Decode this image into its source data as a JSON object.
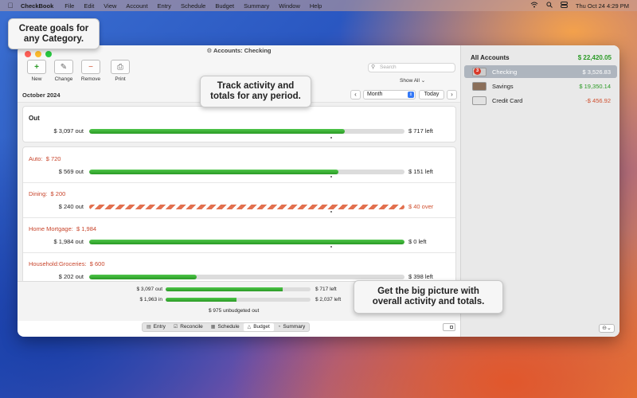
{
  "menubar": {
    "app": "CheckBook",
    "items": [
      "File",
      "Edit",
      "View",
      "Account",
      "Entry",
      "Schedule",
      "Budget",
      "Summary",
      "Window",
      "Help"
    ],
    "clock": "Thu Oct 24  4:29 PM"
  },
  "window": {
    "title": "Accounts:  Checking",
    "toolbar": {
      "new": "New",
      "change": "Change",
      "remove": "Remove",
      "print": "Print",
      "search_placeholder": "Search",
      "show_all": "Show All"
    },
    "period": {
      "date": "October 2024",
      "select": "Month",
      "today": "Today"
    }
  },
  "budget": {
    "out": {
      "title": "Out",
      "amount": "$ 3,097 out",
      "left": "$ 717 left",
      "progress": 0.81
    },
    "categories": [
      {
        "name": "Auto:",
        "goal": "$ 720",
        "amount": "$ 569 out",
        "left": "$ 151 left",
        "progress": 0.79,
        "over": false
      },
      {
        "name": "Dining:",
        "goal": "$ 200",
        "amount": "$ 240 out",
        "left": "$ 40 over",
        "progress": 1.0,
        "over": true
      },
      {
        "name": "Home Mortgage:",
        "goal": "$ 1,984",
        "amount": "$ 1,984 out",
        "left": "$ 0 left",
        "progress": 1.0,
        "over": false
      },
      {
        "name": "Household:Groceries:",
        "goal": "$ 600",
        "amount": "$ 202 out",
        "left": "$ 398 left",
        "progress": 0.34,
        "over": false
      }
    ]
  },
  "summary": {
    "out": {
      "amount": "$ 3,097 out",
      "left": "$ 717 left",
      "progress": 0.81
    },
    "in": {
      "amount": "$ 1,963 in",
      "left": "$ 2,037 left",
      "progress": 0.49
    },
    "unbudgeted": "$ 975 unbudgeted out"
  },
  "tabs": [
    "Entry",
    "Reconcile",
    "Schedule",
    "Budget",
    "Summary"
  ],
  "sidebar": {
    "header": "All Accounts",
    "total": "$ 22,420.05",
    "accounts": [
      {
        "name": "Checking",
        "value": "$ 3,526.83",
        "badge": "3"
      },
      {
        "name": "Savings",
        "value": "$ 19,350.14"
      },
      {
        "name": "Credit Card",
        "value": "-$ 456.92"
      }
    ]
  },
  "callouts": {
    "goals": [
      "Create goals for",
      "any Category."
    ],
    "track": [
      "Track activity and",
      "totals for any period."
    ],
    "picture": [
      "Get the big picture with",
      "overall activity and totals."
    ]
  },
  "colors": {
    "green": "#2a9a25",
    "red": "#d0502f",
    "accent": "#3478f6"
  }
}
